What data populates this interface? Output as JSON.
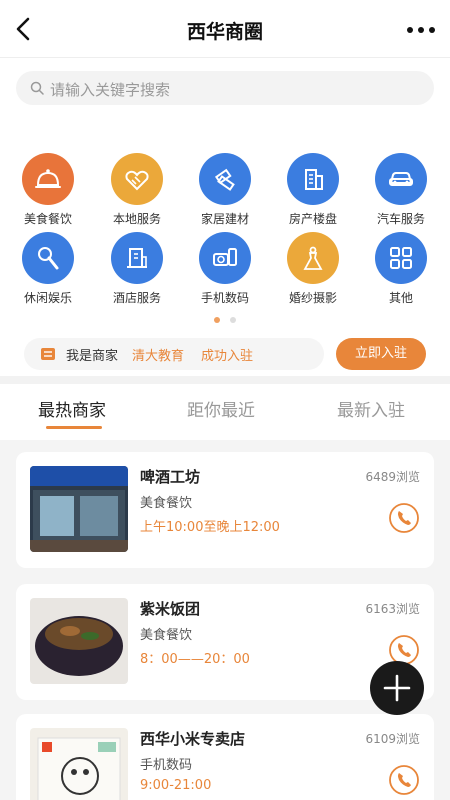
{
  "header": {
    "title": "西华商圈"
  },
  "search": {
    "placeholder": "请输入关键字搜索"
  },
  "categories": [
    {
      "label": "美食餐饮",
      "color": "#e8743a",
      "icon": "food-cloche-icon"
    },
    {
      "label": "本地服务",
      "color": "#eba83a",
      "icon": "handshake-icon"
    },
    {
      "label": "家居建材",
      "color": "#3b7de0",
      "icon": "tools-icon"
    },
    {
      "label": "房产楼盘",
      "color": "#3b7de0",
      "icon": "building-icon"
    },
    {
      "label": "汽车服务",
      "color": "#3b7de0",
      "icon": "car-icon"
    },
    {
      "label": "休闲娱乐",
      "color": "#3b7de0",
      "icon": "microphone-icon"
    },
    {
      "label": "酒店服务",
      "color": "#3b7de0",
      "icon": "hotel-icon"
    },
    {
      "label": "手机数码",
      "color": "#3b7de0",
      "icon": "camera-phone-icon"
    },
    {
      "label": "婚纱摄影",
      "color": "#eba83a",
      "icon": "wedding-dress-icon"
    },
    {
      "label": "其他",
      "color": "#3b7de0",
      "icon": "grid-icon"
    }
  ],
  "merchant": {
    "label": "我是商家",
    "name": "清大教育",
    "status": "成功入驻",
    "button": "立即入驻"
  },
  "tabs": [
    {
      "label": "最热商家",
      "active": true
    },
    {
      "label": "距你最近",
      "active": false
    },
    {
      "label": "最新入驻",
      "active": false
    }
  ],
  "shops": [
    {
      "name": "啤酒工坊",
      "category": "美食餐饮",
      "hours": "上午10:00至晚上12:00",
      "views": "6489浏览"
    },
    {
      "name": "紫米饭团",
      "category": "美食餐饮",
      "hours": "8：00——20：00",
      "views": "6163浏览"
    },
    {
      "name": "西华小米专卖店",
      "category": "手机数码",
      "hours": "9:00-21:00",
      "views": "6109浏览"
    }
  ],
  "accent_color": "#e8863a"
}
